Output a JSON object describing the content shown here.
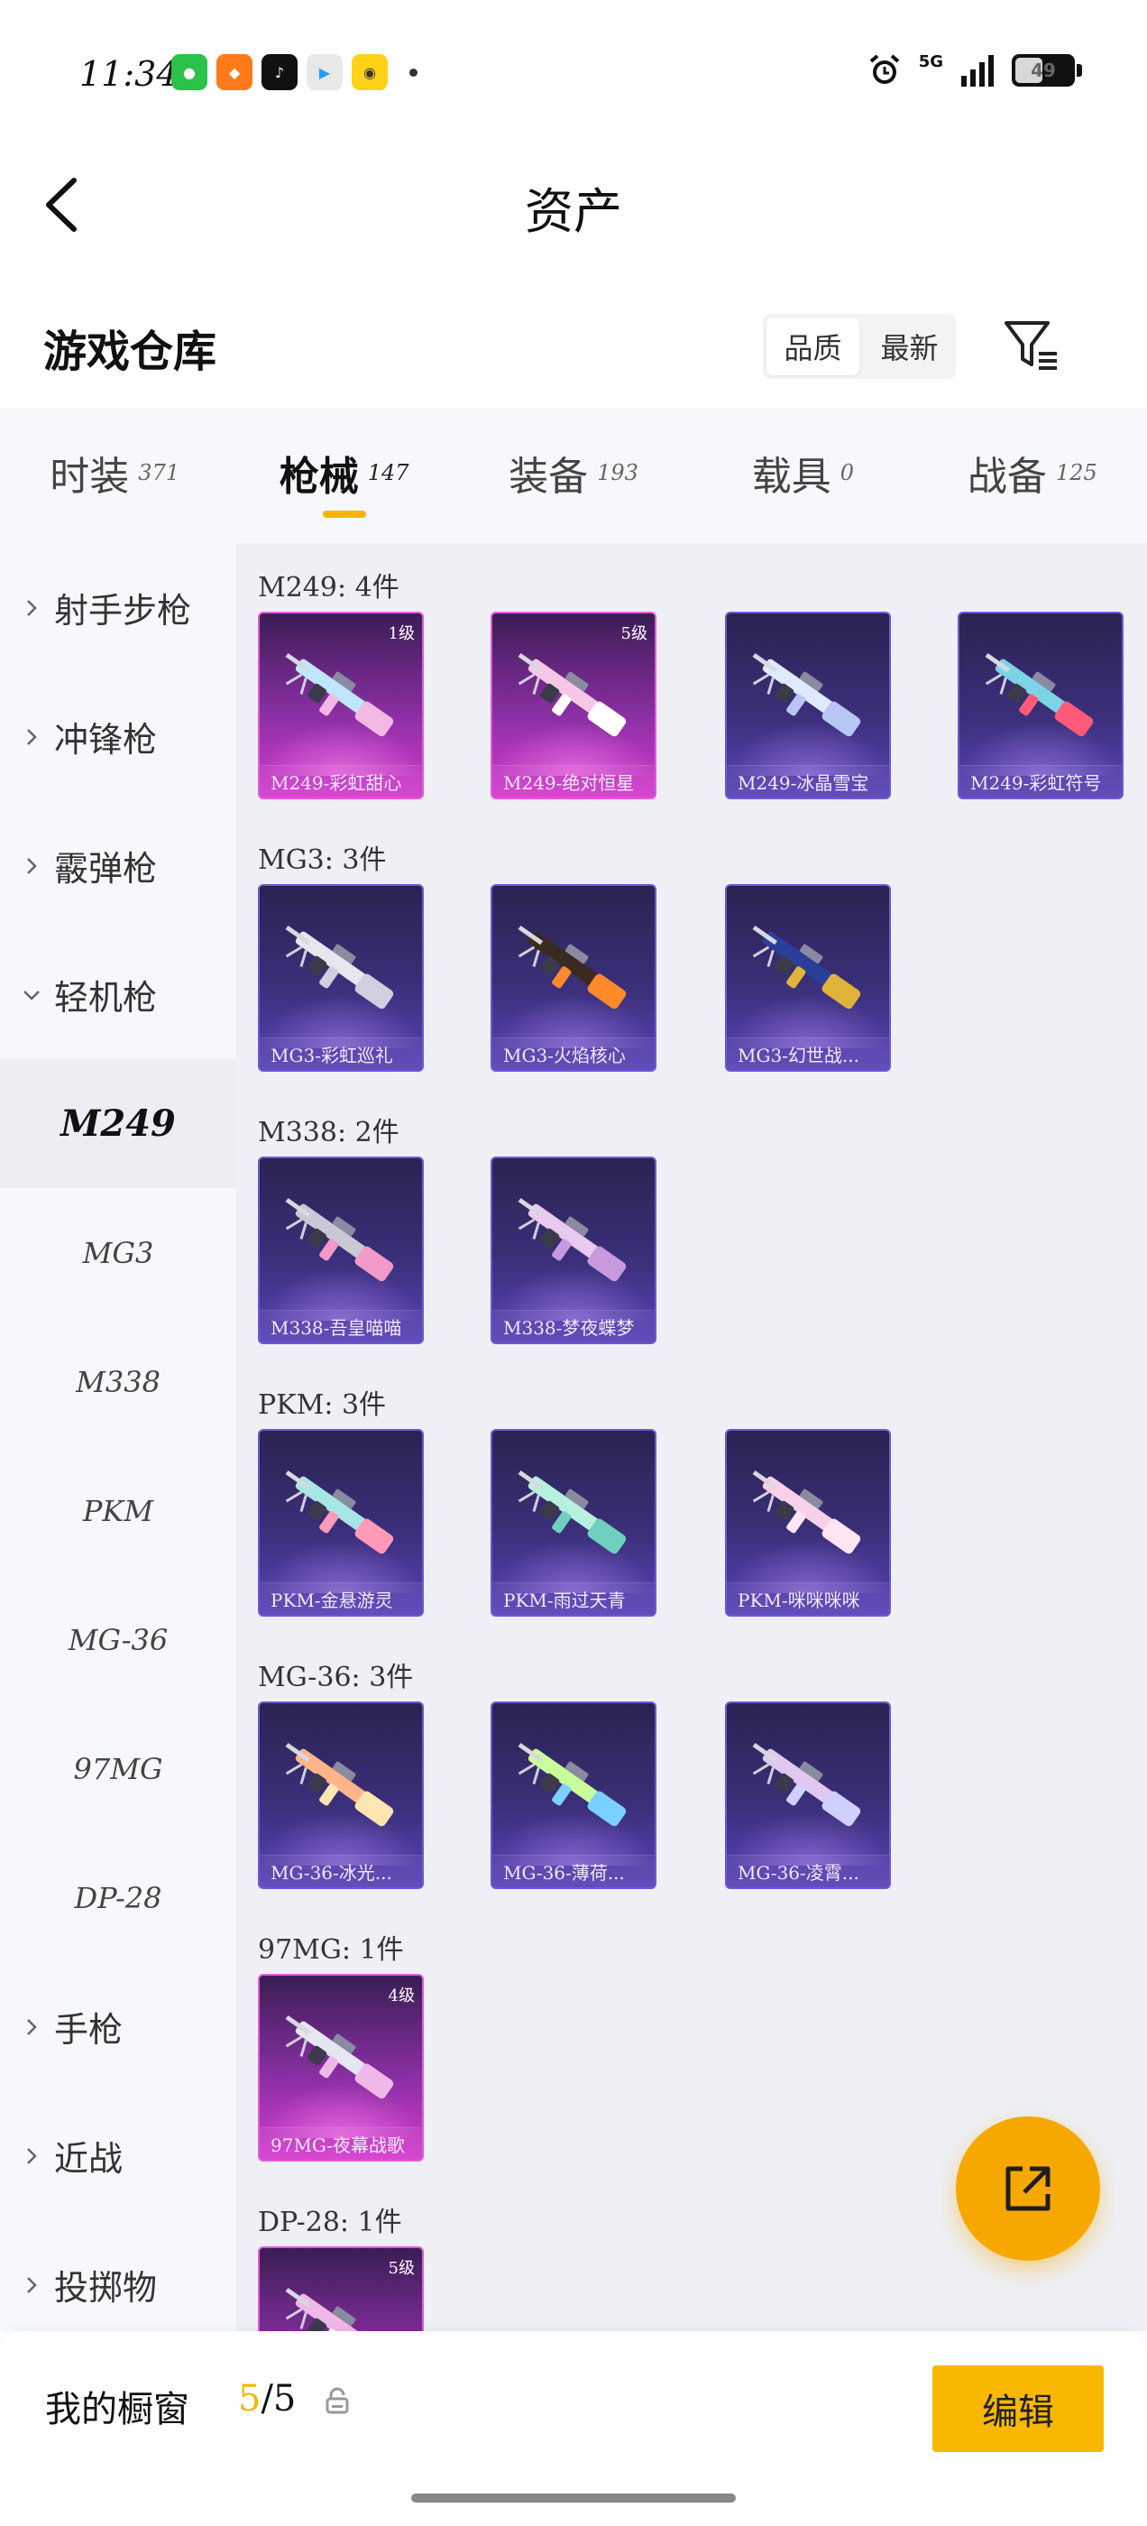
{
  "status_bar": {
    "time": "11:34",
    "network": "5G",
    "battery": "49",
    "battery_level": 0.49
  },
  "header": {
    "title": "资产"
  },
  "warehouse": {
    "title": "游戏仓库",
    "sort_options": [
      "品质",
      "最新"
    ],
    "sort_selected": "品质"
  },
  "tabs": [
    {
      "label": "时装",
      "count": "371"
    },
    {
      "label": "枪械",
      "count": "147",
      "active": true
    },
    {
      "label": "装备",
      "count": "193"
    },
    {
      "label": "载具",
      "count": "0"
    },
    {
      "label": "战备",
      "count": "125"
    }
  ],
  "sidebar": {
    "categories": {
      "rifle": "射手步枪",
      "smg": "冲锋枪",
      "shotgun": "霰弹枪",
      "lmg": "轻机枪",
      "pistol": "手枪",
      "melee": "近战",
      "throwable": "投掷物"
    },
    "lmg_items": [
      "M249",
      "MG3",
      "M338",
      "PKM",
      "MG-36",
      "97MG",
      "DP-28"
    ],
    "selected": "M249"
  },
  "groups": [
    {
      "title": "M249: 4件",
      "items": [
        {
          "name": "M249-彩虹甜心",
          "level": "1级",
          "rarity": "pink"
        },
        {
          "name": "M249-绝对恒星",
          "level": "5级",
          "rarity": "pink"
        },
        {
          "name": "M249-冰晶雪宝",
          "level": "",
          "rarity": "purple"
        },
        {
          "name": "M249-彩虹符号",
          "level": "",
          "rarity": "purple"
        }
      ]
    },
    {
      "title": "MG3: 3件",
      "items": [
        {
          "name": "MG3-彩虹巡礼",
          "level": "",
          "rarity": "purple"
        },
        {
          "name": "MG3-火焰核心",
          "level": "",
          "rarity": "purple"
        },
        {
          "name": "MG3-幻世战...",
          "level": "",
          "rarity": "purple"
        }
      ]
    },
    {
      "title": "M338: 2件",
      "items": [
        {
          "name": "M338-吾皇喵喵",
          "level": "",
          "rarity": "purple"
        },
        {
          "name": "M338-梦夜蝶梦",
          "level": "",
          "rarity": "purple"
        }
      ]
    },
    {
      "title": "PKM: 3件",
      "items": [
        {
          "name": "PKM-金悬游灵",
          "level": "",
          "rarity": "purple"
        },
        {
          "name": "PKM-雨过天青",
          "level": "",
          "rarity": "purple"
        },
        {
          "name": "PKM-咪咪咪咪",
          "level": "",
          "rarity": "purple"
        }
      ]
    },
    {
      "title": "MG-36: 3件",
      "items": [
        {
          "name": "MG-36-冰光...",
          "level": "",
          "rarity": "purple"
        },
        {
          "name": "MG-36-薄荷...",
          "level": "",
          "rarity": "purple"
        },
        {
          "name": "MG-36-凌霄...",
          "level": "",
          "rarity": "purple"
        }
      ]
    },
    {
      "title": "97MG: 1件",
      "items": [
        {
          "name": "97MG-夜幕战歌",
          "level": "4级",
          "rarity": "pink"
        }
      ]
    },
    {
      "title": "DP-28: 1件",
      "items": [
        {
          "name": "",
          "level": "5级",
          "rarity": "pink"
        }
      ]
    }
  ],
  "bottom_bar": {
    "showcase_label": "我的橱窗",
    "count_current": "5",
    "count_total": "/5",
    "edit_label": "编辑"
  },
  "colors": {
    "accent": "#f7b500",
    "epic": "#5a42b8",
    "legendary": "#d63ccf"
  }
}
